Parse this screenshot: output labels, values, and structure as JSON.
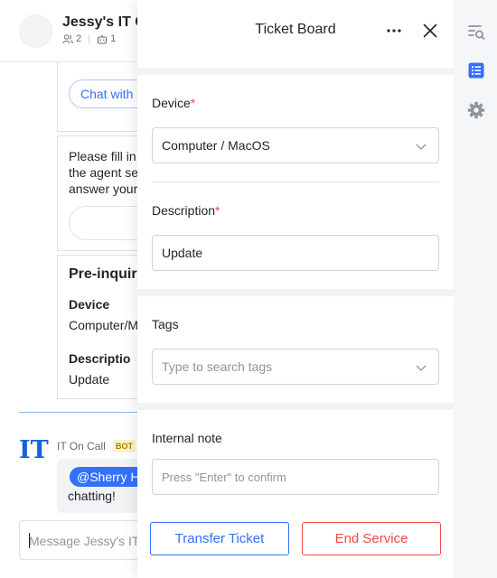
{
  "chat": {
    "title": "Jessy's IT C",
    "member_count": "2",
    "bot_count": "1",
    "chat_with_label": "Chat with",
    "prompt_line1": "Please fill in",
    "prompt_line2": "the agent se",
    "prompt_line3": "answer your",
    "preinquiry_title": "Pre-inquir",
    "device_label": "Device",
    "device_value": "Computer/M",
    "description_label": "Descriptio",
    "description_value": "Update",
    "bot_logo_text": "IT",
    "bot_name": "IT On Call",
    "bot_tag": "BOT",
    "mention": "@Sherry H",
    "bubble_text": "chatting!",
    "message_placeholder": "Message Jessy's IT"
  },
  "drawer": {
    "title": "Ticket Board",
    "device_label": "Device",
    "device_value": "Computer / MacOS",
    "description_label": "Description",
    "description_value": "Update",
    "tags_label": "Tags",
    "tags_placeholder": "Type to search tags",
    "internal_note_label": "Internal note",
    "internal_note_placeholder": "Press \"Enter\" to confirm",
    "required_marker": "*",
    "transfer_button": "Transfer Ticket",
    "end_button": "End Service"
  },
  "colors": {
    "accent": "#3370ff",
    "danger": "#f54a45",
    "bot_blue": "#1c5fd8"
  },
  "icons": {
    "rail": [
      "search-list-icon",
      "ticket-list-icon",
      "gear-icon"
    ],
    "drawer": [
      "more-icon",
      "close-icon",
      "chevron-down-icon"
    ]
  }
}
